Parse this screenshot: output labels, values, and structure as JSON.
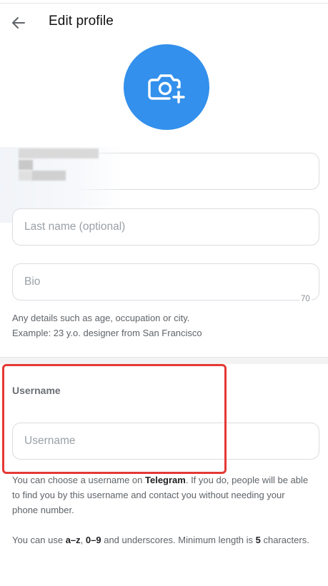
{
  "header": {
    "title": "Edit profile"
  },
  "fields": {
    "last_name_placeholder": "Last name (optional)",
    "bio_placeholder": "Bio",
    "bio_counter": "70",
    "username_placeholder": "Username"
  },
  "bio_help": {
    "line1": "Any details such as age, occupation or city.",
    "line2": "Example: 23 y.o. designer from San Francisco"
  },
  "username_section": {
    "label": "Username",
    "info1_part1": "You can choose a username on ",
    "info1_bold": "Telegram",
    "info1_part2": ". If you do, people will be able to find you by this username and contact you without needing your phone number.",
    "info2_part1": "You can use ",
    "info2_bold1": "a–z",
    "info2_sep": ", ",
    "info2_bold2": "0–9",
    "info2_part2": " and underscores. Minimum length is ",
    "info2_bold3": "5",
    "info2_part3": " characters."
  },
  "colors": {
    "accent": "#3390ec",
    "highlight": "#e53935"
  },
  "icons": {
    "back": "arrow-left-icon",
    "avatar": "camera-add-icon"
  }
}
